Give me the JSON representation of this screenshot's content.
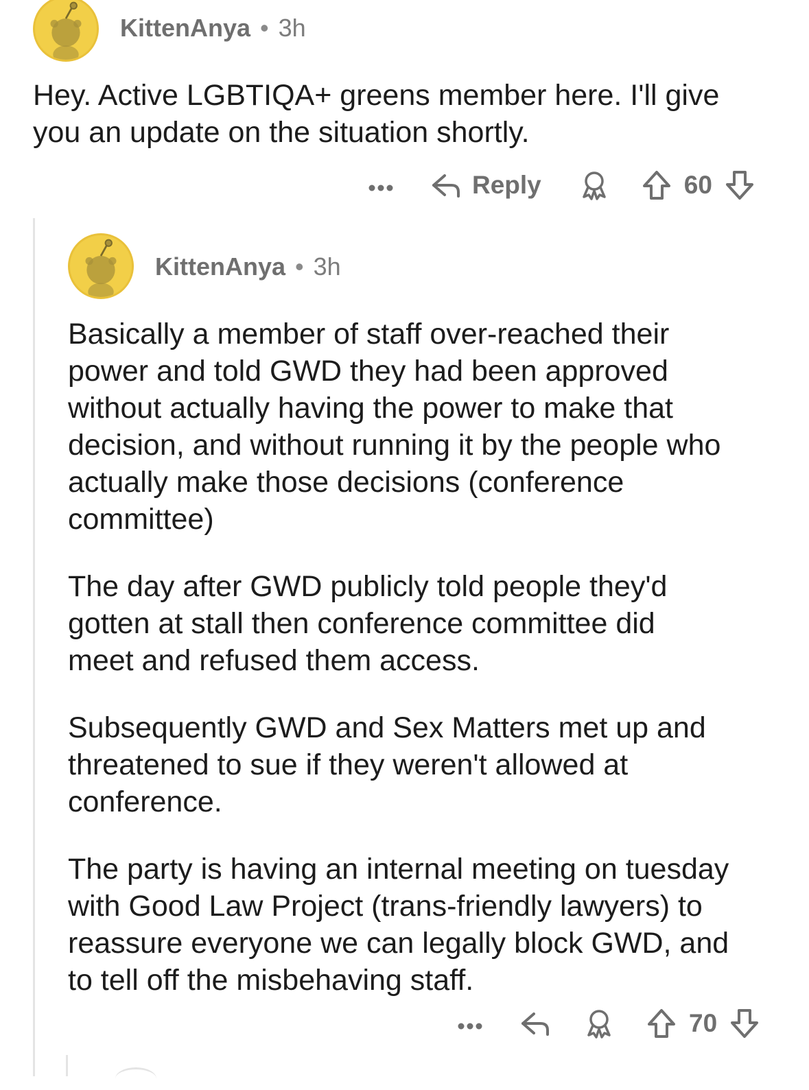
{
  "comments": [
    {
      "username": "KittenAnya",
      "separator": "•",
      "time": "3h",
      "text_lines": [
        "Hey. Active LGBTIQA+ greens member here. I'll give",
        "you an update on the situation shortly."
      ],
      "actions": {
        "more_icon": "more-dots-icon",
        "reply_label": "Reply",
        "award_icon": "award-icon",
        "upvote_icon": "upvote-arrow-icon",
        "score": "60",
        "downvote_icon": "downvote-arrow-icon"
      }
    },
    {
      "username": "KittenAnya",
      "separator": "•",
      "time": "3h",
      "paragraphs": [
        [
          "Basically a member of staff over-reached their",
          "power and told GWD they had been approved",
          "without actually having the power to make that",
          "decision, and without running it by the people who",
          "actually make those decisions (conference",
          "committee)"
        ],
        [
          "The day after GWD publicly told people they'd",
          "gotten at stall then conference committee did",
          "meet and refused them access."
        ],
        [
          "Subsequently GWD and Sex Matters met up and",
          "threatened to sue if they weren't allowed at",
          "conference."
        ],
        [
          "The party is having an internal meeting on tuesday",
          "with Good Law Project (trans-friendly lawyers) to",
          "reassure everyone we can legally block GWD, and",
          "to tell off the misbehaving staff."
        ]
      ],
      "actions": {
        "more_icon": "more-dots-icon",
        "reply_icon": "reply-arrow-icon",
        "award_icon": "award-icon",
        "upvote_icon": "upvote-arrow-icon",
        "score": "70",
        "downvote_icon": "downvote-arrow-icon"
      }
    }
  ],
  "colors": {
    "avatar": "#f2cf48",
    "text": "#1c1c1c",
    "meta": "#7c7c7c",
    "thread_line": "#e4e4e4"
  }
}
